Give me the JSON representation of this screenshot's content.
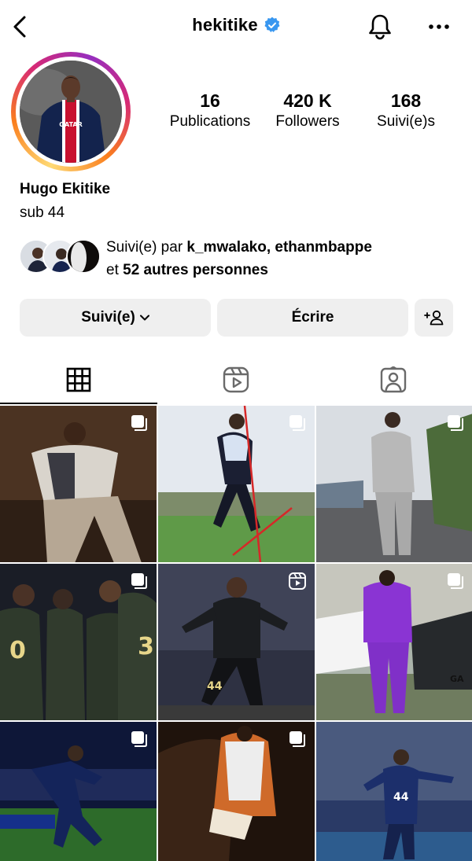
{
  "header": {
    "username": "hekitike",
    "verified": true,
    "back_icon": "chevron-left-icon",
    "bell_icon": "bell-icon",
    "more_icon": "more-horizontal-icon"
  },
  "profile": {
    "stats": {
      "posts_count": "16",
      "posts_label": "Publications",
      "followers_count": "420 K",
      "followers_label": "Followers",
      "following_count": "168",
      "following_label": "Suivi(e)s"
    },
    "full_name": "Hugo Ekitike",
    "bio": "sub 44",
    "mutual": {
      "prefix": "Suivi(e) par ",
      "names": "k_mwalako, ethanmbappe",
      "line2_prefix": "et ",
      "others": "52 autres personnes"
    }
  },
  "actions": {
    "follow_label": "Suivi(e)",
    "message_label": "Écrire",
    "add_icon": "add-person-icon"
  },
  "tabs": [
    {
      "name": "grid",
      "icon": "grid-icon",
      "active": true
    },
    {
      "name": "reels",
      "icon": "reels-icon",
      "active": false
    },
    {
      "name": "tagged",
      "icon": "tagged-icon",
      "active": false
    }
  ],
  "colors": {
    "verified_blue": "#3897f0",
    "button_bg": "#efefef",
    "ring_gradient": [
      "#feda75",
      "#fa7e1e",
      "#d62976",
      "#962fbf"
    ]
  },
  "posts": [
    {
      "type": "carousel",
      "colors": [
        "#5a3e2b",
        "#2a1c12"
      ]
    },
    {
      "type": "carousel",
      "colors": [
        "#c9d6e6",
        "#5f8f4e"
      ]
    },
    {
      "type": "carousel",
      "colors": [
        "#d7dbe0",
        "#7a8a6a"
      ]
    },
    {
      "type": "carousel",
      "colors": [
        "#1d2230",
        "#3f4a3a"
      ]
    },
    {
      "type": "reel",
      "colors": [
        "#2f3142",
        "#0f0f14"
      ]
    },
    {
      "type": "carousel",
      "colors": [
        "#a7b0a6",
        "#8b35d6"
      ]
    },
    {
      "type": "carousel",
      "colors": [
        "#0e1738",
        "#2d6b2a"
      ]
    },
    {
      "type": "carousel",
      "colors": [
        "#2a1a10",
        "#c56a2a"
      ]
    },
    {
      "type": "none",
      "colors": [
        "#b8c2d1",
        "#2a3a66"
      ]
    }
  ]
}
